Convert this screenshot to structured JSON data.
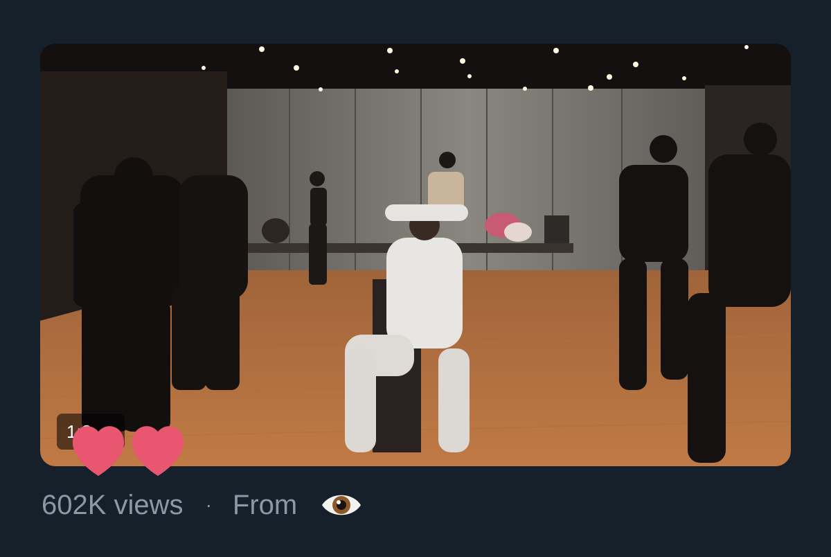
{
  "video": {
    "duration_label": "1:3",
    "scene": "dance-practice-room"
  },
  "reactions": [
    "heart-icon",
    "heart-icon"
  ],
  "meta": {
    "views": "602K views",
    "separator": "·",
    "from_label": "From",
    "source_icon": "eye-icon"
  },
  "colors": {
    "background": "#15202b",
    "secondary_text": "#8b98a5",
    "heart": "#e8566f"
  }
}
